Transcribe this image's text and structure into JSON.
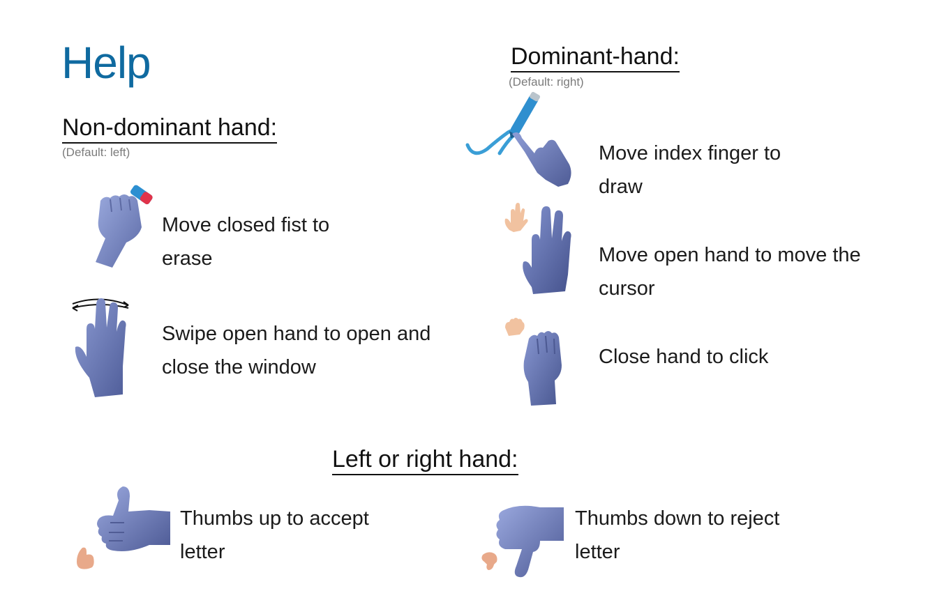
{
  "page": {
    "title": "Help",
    "accent_color": "#0f6aa0",
    "hand_color": "#7b8bc2"
  },
  "non_dominant": {
    "heading": "Non-dominant hand:",
    "note": "(Default: left)",
    "items": [
      {
        "icon": "closed-fist-eraser-icon",
        "text": "Move closed fist to erase"
      },
      {
        "icon": "swipe-open-hand-icon",
        "text": "Swipe open hand to open and close the window"
      }
    ]
  },
  "dominant": {
    "heading": "Dominant-hand:",
    "note": "(Default: right)",
    "items": [
      {
        "icon": "index-finger-draw-icon",
        "text": "Move index finger to draw"
      },
      {
        "icon": "open-hand-cursor-icon",
        "text": "Move open hand to move the cursor"
      },
      {
        "icon": "close-hand-click-icon",
        "text": "Close hand to click"
      }
    ]
  },
  "either": {
    "heading": "Left or right hand:",
    "items": [
      {
        "icon": "thumbs-up-icon",
        "text": "Thumbs up to accept letter"
      },
      {
        "icon": "thumbs-down-icon",
        "text": "Thumbs down to reject letter"
      }
    ]
  }
}
